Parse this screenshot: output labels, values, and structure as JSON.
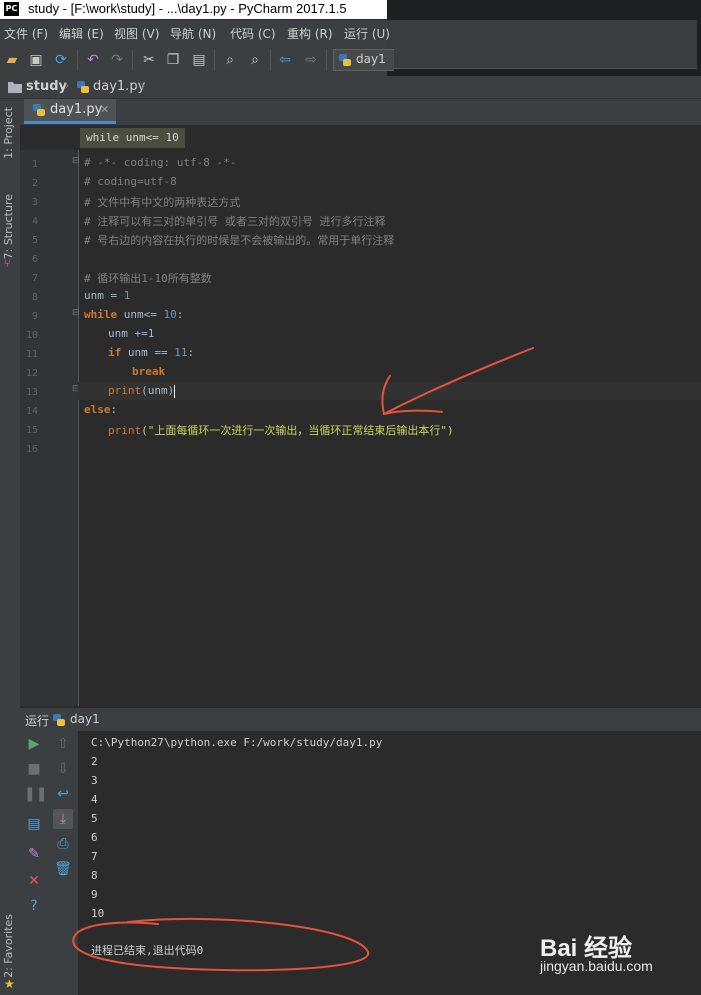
{
  "window": {
    "title": "study - [F:\\work\\study] - ...\\day1.py - PyCharm 2017.1.5",
    "app_badge": "PC"
  },
  "menu": [
    "文件 (F)",
    "编辑 (E)",
    "视图 (V)",
    "导航 (N)",
    "代码 (C)",
    "重构 (R)",
    "运行 (U)"
  ],
  "toolbar": {
    "icons": [
      "open-icon",
      "save-icon",
      "sync-icon",
      "undo-icon",
      "redo-icon",
      "cut-icon",
      "copy-icon",
      "paste-icon",
      "find-icon",
      "replace-icon",
      "back-icon",
      "forward-icon"
    ],
    "run_config": "day1"
  },
  "breadcrumb": [
    "study",
    "day1.py"
  ],
  "side_tabs": {
    "project": "1: Project",
    "structure": "7: Structure",
    "favorites": "2: Favorites"
  },
  "editor": {
    "tab_label": "day1.py",
    "hint": "while unm<= 10",
    "line_numbers": [
      "1",
      "2",
      "3",
      "4",
      "5",
      "6",
      "7",
      "8",
      "9",
      "10",
      "11",
      "12",
      "13",
      "14",
      "15",
      "16"
    ],
    "lines": {
      "l1": "# -*- coding: utf-8 -*-",
      "l2": "# coding=utf-8",
      "l3": "# 文件中有中文的两种表达方式",
      "l4": "# 注释可以有三对的单引号 或者三对的双引号 进行多行注释",
      "l5": "# 号右边的内容在执行的时候是不会被输出的。常用于单行注释",
      "l7": "# 循环输出1-10所有整数",
      "l8a": "unm = ",
      "l8b": "1",
      "l9a": "while",
      "l9b": " unm<= ",
      "l9c": "10",
      "l9d": ":",
      "l10": "unm +=1",
      "l11a": "if",
      "l11b": " unm == ",
      "l11c": "11",
      "l11d": ":",
      "l12": "break",
      "l13a": "print",
      "l13b": "(unm)",
      "l14a": "else",
      "l14b": ":",
      "l15a": "print",
      "l15b": "(\"上面每循环一次进行一次输出，当循环正常结束后输出本行\")"
    }
  },
  "run_panel": {
    "header_label": "运行",
    "config": "day1",
    "command": "C:\\Python27\\python.exe F:/work/study/day1.py",
    "output": [
      "2",
      "3",
      "4",
      "5",
      "6",
      "7",
      "8",
      "9",
      "10"
    ],
    "exit_message": "进程已结束,退出代码0"
  },
  "watermark": {
    "brand": "Bai 经验",
    "url": "jingyan.baidu.com"
  },
  "colors": {
    "editor_bg": "#2b2b2b",
    "keyword": "#cc7832",
    "number": "#6897bb",
    "comment": "#808080",
    "string": "#c9d55f",
    "annotation": "#e5533d"
  }
}
